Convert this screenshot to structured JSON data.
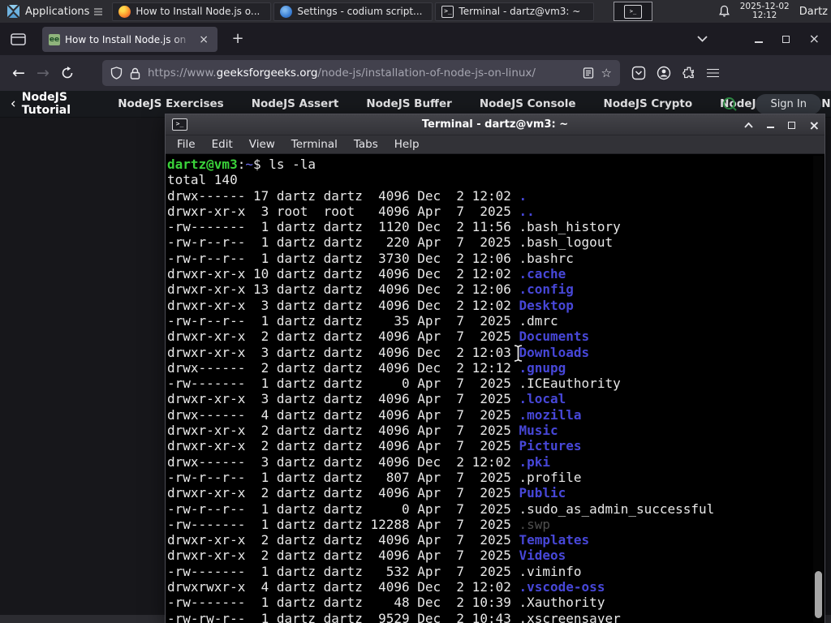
{
  "icons": {
    "back": "←",
    "forward": "→",
    "new_tab": "+",
    "close_tab": "×",
    "window_close": "×",
    "star": "☆",
    "terminal_glyph": ">_",
    "favicon_text": "ee"
  },
  "panel": {
    "applications_label": "Applications",
    "windows": [
      {
        "icon": "firefox",
        "title": "How to Install Node.js o..."
      },
      {
        "icon": "vscodium",
        "title": "Settings - codium script..."
      },
      {
        "icon": "terminal",
        "title": "Terminal - dartz@vm3: ~"
      }
    ],
    "clock_date": "2025-12-02",
    "clock_time": "12:12",
    "user": "Dartz"
  },
  "browser": {
    "tab_title": "How to Install Node.js on",
    "url_scheme": "https://www.",
    "url_domain": "geeksforgeeks.org",
    "url_path": "/node-js/installation-of-node-js-on-linux/"
  },
  "site_nav": {
    "back_item": "NodeJS Tutorial",
    "items": [
      "NodeJS Exercises",
      "NodeJS Assert",
      "NodeJS Buffer",
      "NodeJS Console",
      "NodeJS Crypto",
      "NodeJS DNS",
      "Node"
    ],
    "sign_in": "Sign In",
    "accent_green": "#2f8d46"
  },
  "terminal": {
    "title": "Terminal - dartz@vm3: ~",
    "menu": [
      "File",
      "Edit",
      "View",
      "Terminal",
      "Tabs",
      "Help"
    ],
    "prompt": {
      "user_host": "dartz@vm3",
      "colon": ":",
      "cwd": "~",
      "dollar": "$ ",
      "command": "ls -la"
    },
    "total_line": "total 140",
    "colors": {
      "directory": "#4747d8",
      "prompt_green": "#3ad23a",
      "dim_file": "#4f4f4f"
    },
    "listing": [
      {
        "pre": "drwx------ 17 dartz dartz  4096 Dec  2 12:02 ",
        "name": ".",
        "type": "dir"
      },
      {
        "pre": "drwxr-xr-x  3 root  root   4096 Apr  7  2025 ",
        "name": "..",
        "type": "dir"
      },
      {
        "pre": "-rw-------  1 dartz dartz  1120 Dec  2 11:56 ",
        "name": ".bash_history",
        "type": "plain"
      },
      {
        "pre": "-rw-r--r--  1 dartz dartz   220 Apr  7  2025 ",
        "name": ".bash_logout",
        "type": "plain"
      },
      {
        "pre": "-rw-r--r--  1 dartz dartz  3730 Dec  2 12:06 ",
        "name": ".bashrc",
        "type": "plain"
      },
      {
        "pre": "drwxr-xr-x 10 dartz dartz  4096 Dec  2 12:02 ",
        "name": ".cache",
        "type": "dir"
      },
      {
        "pre": "drwxr-xr-x 13 dartz dartz  4096 Dec  2 12:06 ",
        "name": ".config",
        "type": "dir"
      },
      {
        "pre": "drwxr-xr-x  3 dartz dartz  4096 Dec  2 12:02 ",
        "name": "Desktop",
        "type": "dir"
      },
      {
        "pre": "-rw-r--r--  1 dartz dartz    35 Apr  7  2025 ",
        "name": ".dmrc",
        "type": "plain"
      },
      {
        "pre": "drwxr-xr-x  2 dartz dartz  4096 Apr  7  2025 ",
        "name": "Documents",
        "type": "dir"
      },
      {
        "pre": "drwxr-xr-x  3 dartz dartz  4096 Dec  2 12:03 ",
        "name": "Downloads",
        "type": "dir"
      },
      {
        "pre": "drwx------  2 dartz dartz  4096 Dec  2 12:12 ",
        "name": ".gnupg",
        "type": "dir"
      },
      {
        "pre": "-rw-------  1 dartz dartz     0 Apr  7  2025 ",
        "name": ".ICEauthority",
        "type": "plain"
      },
      {
        "pre": "drwxr-xr-x  3 dartz dartz  4096 Apr  7  2025 ",
        "name": ".local",
        "type": "dir"
      },
      {
        "pre": "drwx------  4 dartz dartz  4096 Apr  7  2025 ",
        "name": ".mozilla",
        "type": "dir"
      },
      {
        "pre": "drwxr-xr-x  2 dartz dartz  4096 Apr  7  2025 ",
        "name": "Music",
        "type": "dir"
      },
      {
        "pre": "drwxr-xr-x  2 dartz dartz  4096 Apr  7  2025 ",
        "name": "Pictures",
        "type": "dir"
      },
      {
        "pre": "drwx------  3 dartz dartz  4096 Dec  2 12:02 ",
        "name": ".pki",
        "type": "dir"
      },
      {
        "pre": "-rw-r--r--  1 dartz dartz   807 Apr  7  2025 ",
        "name": ".profile",
        "type": "plain"
      },
      {
        "pre": "drwxr-xr-x  2 dartz dartz  4096 Apr  7  2025 ",
        "name": "Public",
        "type": "dir"
      },
      {
        "pre": "-rw-r--r--  1 dartz dartz     0 Apr  7  2025 ",
        "name": ".sudo_as_admin_successful",
        "type": "plain"
      },
      {
        "pre": "-rw-------  1 dartz dartz 12288 Apr  7  2025 ",
        "name": ".swp",
        "type": "dim"
      },
      {
        "pre": "drwxr-xr-x  2 dartz dartz  4096 Apr  7  2025 ",
        "name": "Templates",
        "type": "dir"
      },
      {
        "pre": "drwxr-xr-x  2 dartz dartz  4096 Apr  7  2025 ",
        "name": "Videos",
        "type": "dir"
      },
      {
        "pre": "-rw-------  1 dartz dartz   532 Apr  7  2025 ",
        "name": ".viminfo",
        "type": "plain"
      },
      {
        "pre": "drwxrwxr-x  4 dartz dartz  4096 Dec  2 12:02 ",
        "name": ".vscode-oss",
        "type": "dir"
      },
      {
        "pre": "-rw-------  1 dartz dartz    48 Dec  2 10:39 ",
        "name": ".Xauthority",
        "type": "plain"
      },
      {
        "pre": "-rw-rw-r--  1 dartz dartz  9529 Dec  2 10:43 ",
        "name": ".xscreensaver",
        "type": "plain"
      }
    ]
  }
}
